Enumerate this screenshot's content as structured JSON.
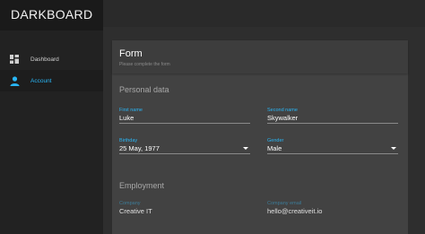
{
  "app": {
    "title": "DARKBOARD"
  },
  "sidebar": {
    "items": [
      {
        "label": "Dashboard",
        "icon": "dashboard-icon",
        "active": false
      },
      {
        "label": "Account",
        "icon": "person-icon",
        "active": true
      }
    ]
  },
  "form": {
    "title": "Form",
    "subtitle": "Please complete the form",
    "personal": {
      "title": "Personal data",
      "first_name": {
        "label": "First name",
        "value": "Luke"
      },
      "second_name": {
        "label": "Second name",
        "value": "Skywalker"
      },
      "birthday": {
        "label": "Birthday",
        "value": "25 May, 1977"
      },
      "gender": {
        "label": "Gender",
        "value": "Male"
      }
    },
    "employment": {
      "title": "Employment",
      "company": {
        "label": "Company",
        "value": "Creative IT"
      },
      "company_email": {
        "label": "Company email",
        "value": "hello@creativeit.io"
      }
    }
  },
  "colors": {
    "accent": "#29b6f6",
    "sidebar": "#222222",
    "card": "#424242"
  }
}
